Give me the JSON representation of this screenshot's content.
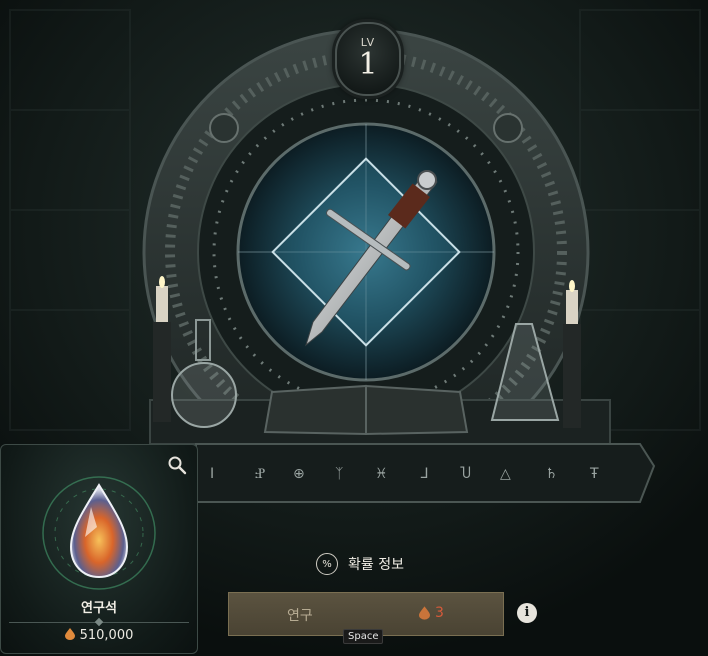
{
  "level": {
    "label": "LV",
    "value": "1"
  },
  "research_item": {
    "name": "연구석",
    "count": "510,000",
    "icons": {
      "search": "search-icon",
      "currency": "gem-icon"
    }
  },
  "probability": {
    "label": "확률 정보",
    "icon": "percent-icon"
  },
  "research_button": {
    "label": "연구",
    "cost": "3",
    "shortcut": "Space"
  },
  "info_button": {
    "label": "i"
  },
  "colors": {
    "accent_gold": "#5b5340",
    "cost_red": "#d65a3a",
    "frame_stone": "#2f3836"
  }
}
